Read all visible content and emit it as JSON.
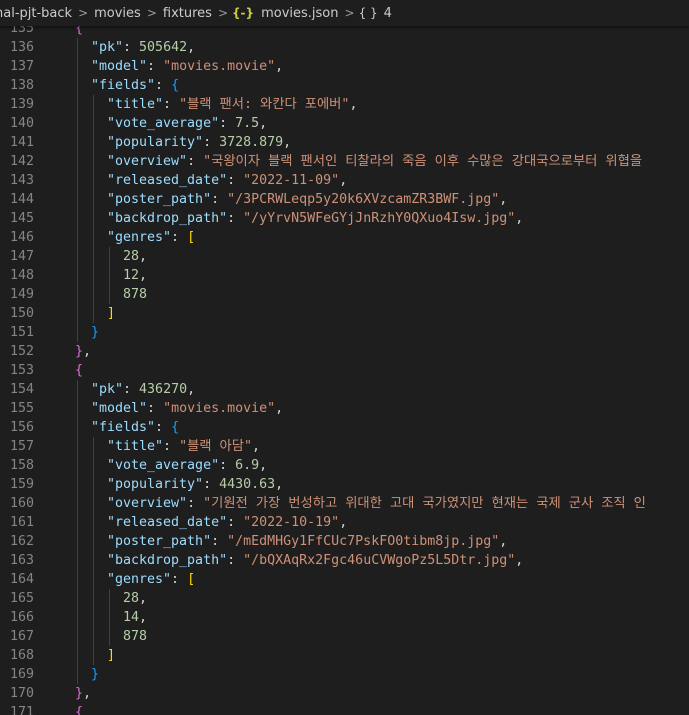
{
  "breadcrumb": {
    "items": [
      "nal-pjt-back",
      "movies",
      "fixtures",
      "movies.json",
      "4"
    ],
    "separator": ">",
    "json_icon": "{-}",
    "object_icon": "{ }"
  },
  "colors": {
    "background": "#1e1e1e",
    "key": "#9cdcfe",
    "string": "#ce9178",
    "number": "#b5cea8",
    "line_number": "#858585",
    "bracket_level1": "#da70d6",
    "bracket_level2": "#179fff",
    "bracket_level3": "#ffd700"
  },
  "editor": {
    "lines": [
      {
        "n": "135",
        "t": [
          [
            "b1",
            "{"
          ]
        ]
      },
      {
        "n": "136",
        "t": [
          [
            "key",
            "\"pk\""
          ],
          [
            "p",
            ": "
          ],
          [
            "num",
            "505642"
          ],
          [
            "p",
            ","
          ]
        ]
      },
      {
        "n": "137",
        "t": [
          [
            "key",
            "\"model\""
          ],
          [
            "p",
            ": "
          ],
          [
            "str",
            "\"movies.movie\""
          ],
          [
            "p",
            ","
          ]
        ]
      },
      {
        "n": "138",
        "t": [
          [
            "key",
            "\"fields\""
          ],
          [
            "p",
            ": "
          ],
          [
            "b2",
            "{"
          ]
        ]
      },
      {
        "n": "139",
        "t": [
          [
            "key",
            "\"title\""
          ],
          [
            "p",
            ": "
          ],
          [
            "str",
            "\"블랙 팬서: 와칸다 포에버\""
          ],
          [
            "p",
            ","
          ]
        ]
      },
      {
        "n": "140",
        "t": [
          [
            "key",
            "\"vote_average\""
          ],
          [
            "p",
            ": "
          ],
          [
            "num",
            "7.5"
          ],
          [
            "p",
            ","
          ]
        ]
      },
      {
        "n": "141",
        "t": [
          [
            "key",
            "\"popularity\""
          ],
          [
            "p",
            ": "
          ],
          [
            "num",
            "3728.879"
          ],
          [
            "p",
            ","
          ]
        ]
      },
      {
        "n": "142",
        "t": [
          [
            "key",
            "\"overview\""
          ],
          [
            "p",
            ": "
          ],
          [
            "str",
            "\"국왕이자 블랙 팬서인 티찰라의 죽음 이후 수많은 강대국으로부터 위협을"
          ]
        ]
      },
      {
        "n": "143",
        "t": [
          [
            "key",
            "\"released_date\""
          ],
          [
            "p",
            ": "
          ],
          [
            "str",
            "\"2022-11-09\""
          ],
          [
            "p",
            ","
          ]
        ]
      },
      {
        "n": "144",
        "t": [
          [
            "key",
            "\"poster_path\""
          ],
          [
            "p",
            ": "
          ],
          [
            "str",
            "\"/3PCRWLeqp5y20k6XVzcamZR3BWF.jpg\""
          ],
          [
            "p",
            ","
          ]
        ]
      },
      {
        "n": "145",
        "t": [
          [
            "key",
            "\"backdrop_path\""
          ],
          [
            "p",
            ": "
          ],
          [
            "str",
            "\"/yYrvN5WFeGYjJnRzhY0QXuo4Isw.jpg\""
          ],
          [
            "p",
            ","
          ]
        ]
      },
      {
        "n": "146",
        "t": [
          [
            "key",
            "\"genres\""
          ],
          [
            "p",
            ": "
          ],
          [
            "b3",
            "["
          ]
        ]
      },
      {
        "n": "147",
        "t": [
          [
            "num",
            "28"
          ],
          [
            "p",
            ","
          ]
        ]
      },
      {
        "n": "148",
        "t": [
          [
            "num",
            "12"
          ],
          [
            "p",
            ","
          ]
        ]
      },
      {
        "n": "149",
        "t": [
          [
            "num",
            "878"
          ]
        ]
      },
      {
        "n": "150",
        "t": [
          [
            "b3",
            "]"
          ]
        ]
      },
      {
        "n": "151",
        "t": [
          [
            "b2",
            "}"
          ]
        ]
      },
      {
        "n": "152",
        "t": [
          [
            "b1",
            "}"
          ],
          [
            "p",
            ","
          ]
        ]
      },
      {
        "n": "153",
        "t": [
          [
            "b1",
            "{"
          ]
        ]
      },
      {
        "n": "154",
        "t": [
          [
            "key",
            "\"pk\""
          ],
          [
            "p",
            ": "
          ],
          [
            "num",
            "436270"
          ],
          [
            "p",
            ","
          ]
        ]
      },
      {
        "n": "155",
        "t": [
          [
            "key",
            "\"model\""
          ],
          [
            "p",
            ": "
          ],
          [
            "str",
            "\"movies.movie\""
          ],
          [
            "p",
            ","
          ]
        ]
      },
      {
        "n": "156",
        "t": [
          [
            "key",
            "\"fields\""
          ],
          [
            "p",
            ": "
          ],
          [
            "b2",
            "{"
          ]
        ]
      },
      {
        "n": "157",
        "t": [
          [
            "key",
            "\"title\""
          ],
          [
            "p",
            ": "
          ],
          [
            "str",
            "\"블랙 아담\""
          ],
          [
            "p",
            ","
          ]
        ]
      },
      {
        "n": "158",
        "t": [
          [
            "key",
            "\"vote_average\""
          ],
          [
            "p",
            ": "
          ],
          [
            "num",
            "6.9"
          ],
          [
            "p",
            ","
          ]
        ]
      },
      {
        "n": "159",
        "t": [
          [
            "key",
            "\"popularity\""
          ],
          [
            "p",
            ": "
          ],
          [
            "num",
            "4430.63"
          ],
          [
            "p",
            ","
          ]
        ]
      },
      {
        "n": "160",
        "t": [
          [
            "key",
            "\"overview\""
          ],
          [
            "p",
            ": "
          ],
          [
            "str",
            "\"기원전 가장 번성하고 위대한 고대 국가였지만 현재는 국제 군사 조직 인"
          ]
        ]
      },
      {
        "n": "161",
        "t": [
          [
            "key",
            "\"released_date\""
          ],
          [
            "p",
            ": "
          ],
          [
            "str",
            "\"2022-10-19\""
          ],
          [
            "p",
            ","
          ]
        ]
      },
      {
        "n": "162",
        "t": [
          [
            "key",
            "\"poster_path\""
          ],
          [
            "p",
            ": "
          ],
          [
            "str",
            "\"/mEdMHGy1FfCUc7PskFO0tibm8jp.jpg\""
          ],
          [
            "p",
            ","
          ]
        ]
      },
      {
        "n": "163",
        "t": [
          [
            "key",
            "\"backdrop_path\""
          ],
          [
            "p",
            ": "
          ],
          [
            "str",
            "\"/bQXAqRx2Fgc46uCVWgoPz5L5Dtr.jpg\""
          ],
          [
            "p",
            ","
          ]
        ]
      },
      {
        "n": "164",
        "t": [
          [
            "key",
            "\"genres\""
          ],
          [
            "p",
            ": "
          ],
          [
            "b3",
            "["
          ]
        ]
      },
      {
        "n": "165",
        "t": [
          [
            "num",
            "28"
          ],
          [
            "p",
            ","
          ]
        ]
      },
      {
        "n": "166",
        "t": [
          [
            "num",
            "14"
          ],
          [
            "p",
            ","
          ]
        ]
      },
      {
        "n": "167",
        "t": [
          [
            "num",
            "878"
          ]
        ]
      },
      {
        "n": "168",
        "t": [
          [
            "b3",
            "]"
          ]
        ]
      },
      {
        "n": "169",
        "t": [
          [
            "b2",
            "}"
          ]
        ]
      },
      {
        "n": "170",
        "t": [
          [
            "b1",
            "}"
          ],
          [
            "p",
            ","
          ]
        ]
      },
      {
        "n": "171",
        "t": [
          [
            "b1",
            "{"
          ]
        ]
      }
    ]
  }
}
